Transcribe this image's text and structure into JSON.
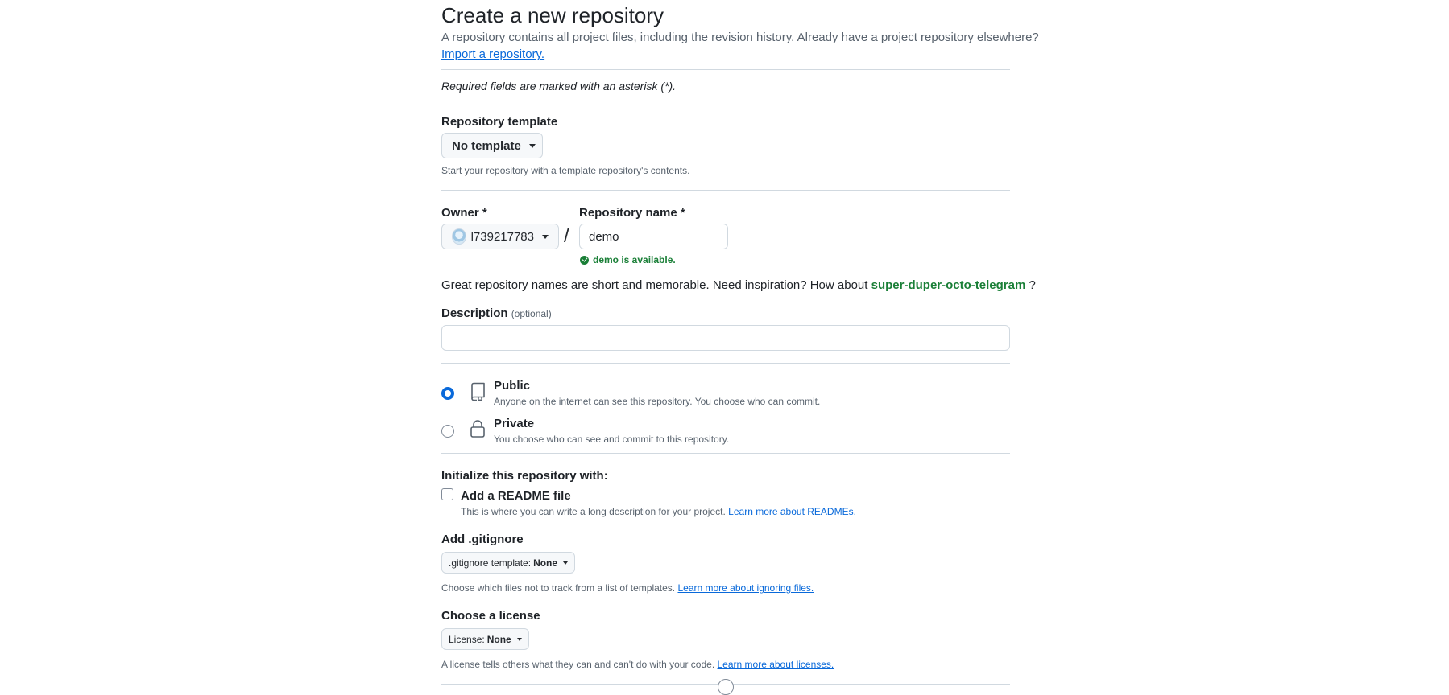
{
  "header": {
    "title": "Create a new repository",
    "subtitle": "A repository contains all project files, including the revision history. Already have a project repository elsewhere?",
    "import_link": "Import a repository."
  },
  "required_note": "Required fields are marked with an asterisk (*).",
  "template": {
    "label": "Repository template",
    "selected": "No template",
    "help": "Start your repository with a template repository's contents."
  },
  "owner": {
    "label": "Owner *",
    "selected": "l739217783"
  },
  "separator": "/",
  "repo_name": {
    "label": "Repository name *",
    "value": "demo",
    "availability": "demo is available."
  },
  "inspiration": {
    "text": "Great repository names are short and memorable. Need inspiration? How about",
    "suggestion": "super-duper-octo-telegram",
    "suffix": "?"
  },
  "description": {
    "label": "Description",
    "optional": "(optional)",
    "value": ""
  },
  "visibility": {
    "public": {
      "title": "Public",
      "desc": "Anyone on the internet can see this repository. You choose who can commit.",
      "checked": true
    },
    "private": {
      "title": "Private",
      "desc": "You choose who can see and commit to this repository.",
      "checked": false
    }
  },
  "init": {
    "heading": "Initialize this repository with:",
    "readme_label": "Add a README file",
    "readme_help": "This is where you can write a long description for your project.",
    "readme_link": "Learn more about READMEs.",
    "readme_checked": false
  },
  "gitignore": {
    "heading": "Add .gitignore",
    "prefix": ".gitignore template:",
    "value": "None",
    "help": "Choose which files not to track from a list of templates.",
    "link": "Learn more about ignoring files."
  },
  "license": {
    "heading": "Choose a license",
    "prefix": "License:",
    "value": "None",
    "help": "A license tells others what they can and can't do with your code.",
    "link": "Learn more about licenses."
  },
  "icons": {
    "repo": "repo-icon",
    "lock": "lock-icon",
    "check": "check-circle-icon",
    "caret": "triangle-down-icon"
  },
  "colors": {
    "accent": "#0969da",
    "success": "#1a7f37",
    "border": "#d1d9e0",
    "muted": "#59636e"
  }
}
